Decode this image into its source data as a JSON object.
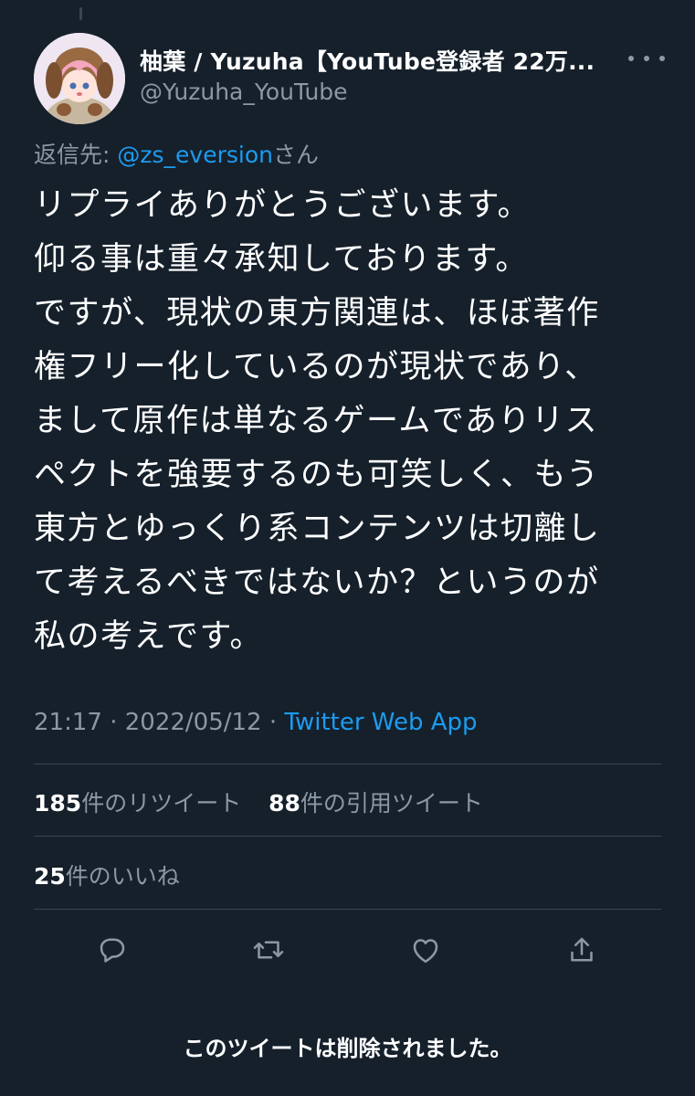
{
  "user": {
    "display_name": "柚葉 / Yuzuha【YouTube登録者 22万...",
    "handle": "@Yuzuha_YouTube"
  },
  "reply_to": {
    "prefix": "返信先:",
    "mention": "@zs_eversion",
    "suffix": "さん"
  },
  "tweet": {
    "text": "リプライありがとうございます。\n仰る事は重々承知しております。\nですが、現状の東方関連は、ほぼ著作\n権フリー化しているのが現状であり、\nまして原作は単なるゲームでありリス\nペクトを強要するのも可笑しく、もう\n東方とゆっくり系コンテンツは切離し\nて考えるべきではないか？というのが\n私の考えです。",
    "time": "21:17",
    "separator": "·",
    "date": "2022/05/12",
    "source": "Twitter Web App"
  },
  "stats": {
    "retweet_count": "185",
    "retweet_label": "件のリツイート",
    "quote_count": "88",
    "quote_label": "件の引用ツイート",
    "like_count": "25",
    "like_label": "件のいいね"
  },
  "icons": {
    "reply": "reply-icon",
    "retweet": "retweet-icon",
    "like": "heart-icon",
    "share": "share-icon",
    "more": "more-icon"
  },
  "colors": {
    "background": "#15202b",
    "text": "#ffffff",
    "secondary": "#8b98a5",
    "link": "#1d9bf0",
    "divider": "#38444d"
  },
  "notice": "このツイートは削除されました。"
}
